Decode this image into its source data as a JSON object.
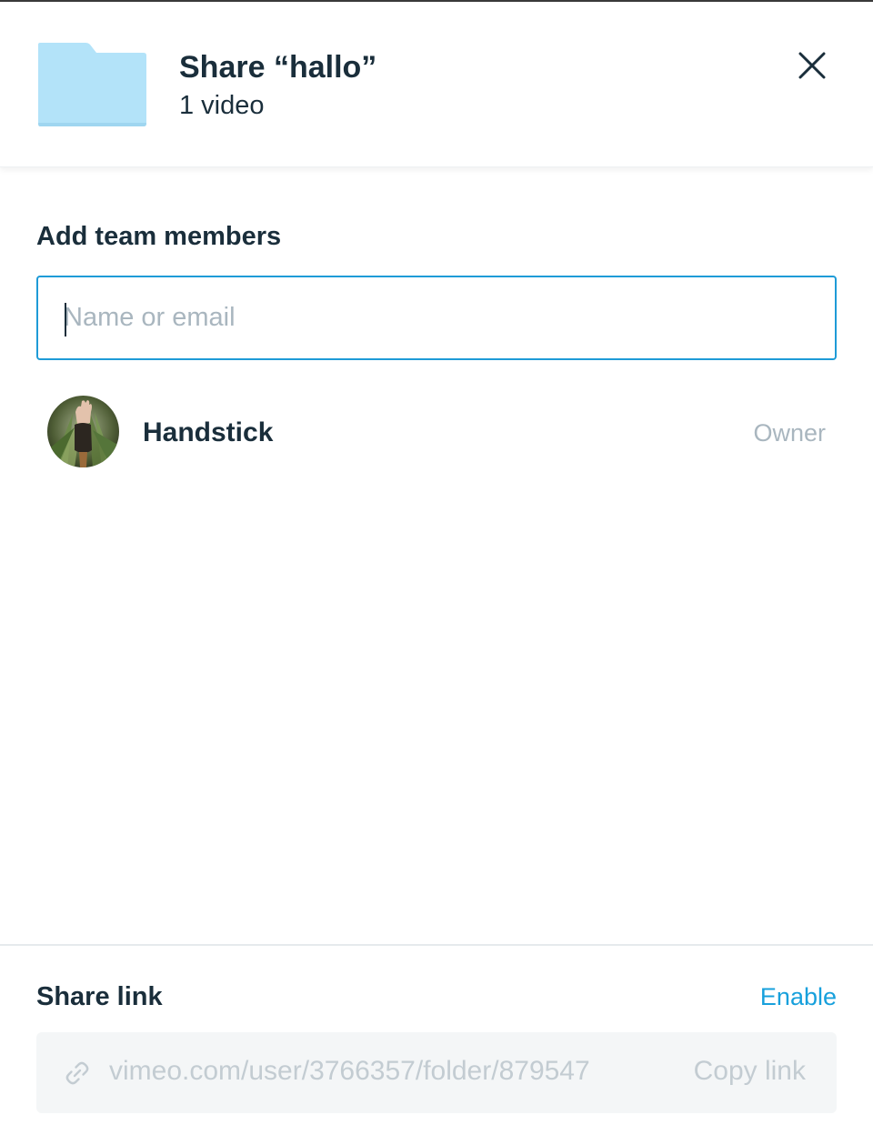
{
  "header": {
    "title": "Share “hallo”",
    "subtitle": "1 video",
    "folder_icon": "folder-icon",
    "folder_color": "#b3e3f9",
    "close_icon": "close-icon"
  },
  "team": {
    "section_label": "Add team members",
    "search_placeholder": "Name or email",
    "search_value": ""
  },
  "members": [
    {
      "name": "Handstick",
      "role": "Owner",
      "avatar": "avatar-photo"
    }
  ],
  "share_link": {
    "label": "Share link",
    "enable_label": "Enable",
    "url": "vimeo.com/user/3766357/folder/879547",
    "copy_label": "Copy link",
    "link_icon": "link-icon",
    "enabled": false
  },
  "colors": {
    "accent": "#17a0dc",
    "focus_border": "#1e9bd7",
    "text_primary": "#1a2e3b",
    "text_muted": "#a9b6bf"
  }
}
